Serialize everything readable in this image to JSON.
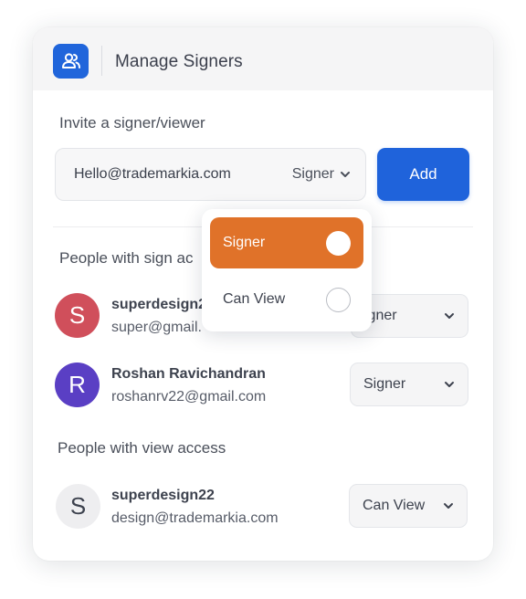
{
  "header": {
    "title": "Manage Signers",
    "icon": "users-icon",
    "icon_bg": "#2065db"
  },
  "invite": {
    "label": "Invite a signer/viewer",
    "email_value": "Hello@trademarkia.com",
    "role_value": "Signer",
    "add_label": "Add",
    "accent": "#1f63db"
  },
  "dropdown": {
    "options": [
      {
        "label": "Signer",
        "selected": true
      },
      {
        "label": "Can View",
        "selected": false
      }
    ],
    "selected_color": "#e07229"
  },
  "sign_access": {
    "label": "People with sign ac",
    "people": [
      {
        "initial": "S",
        "name": "superdesign2",
        "email": "super@gmail.",
        "role": "igner",
        "avatar_color": "#d04f5b"
      },
      {
        "initial": "R",
        "name": "Roshan Ravichandran",
        "email": "roshanrv22@gmail.com",
        "role": "Signer",
        "avatar_color": "#5a3fc4"
      }
    ]
  },
  "view_access": {
    "label": "People with view access",
    "people": [
      {
        "initial": "S",
        "name": "superdesign22",
        "email": "design@trademarkia.com",
        "role": "Can View",
        "avatar_color": "#eeeef0"
      }
    ]
  }
}
